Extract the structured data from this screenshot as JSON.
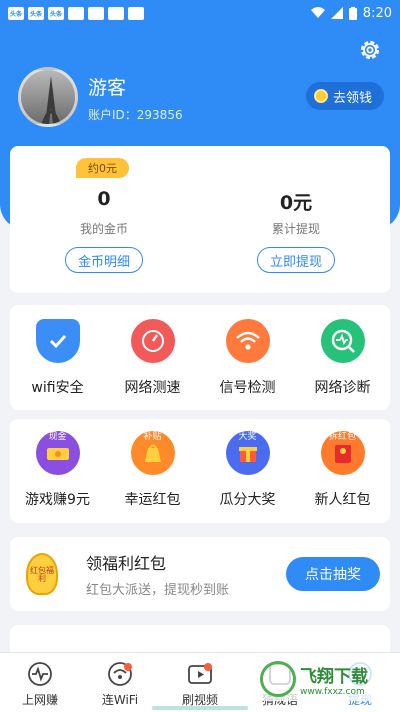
{
  "status_bar": {
    "time": "8:20",
    "left_icons": [
      "头条",
      "头条",
      "头条"
    ]
  },
  "profile": {
    "username": "游客",
    "account_id": "账户ID：293856",
    "go_button": "去领钱"
  },
  "stats": {
    "badge": "约0元",
    "coins": {
      "value": "0",
      "label": "我的金币",
      "button": "金币明细"
    },
    "withdraw": {
      "value": "0元",
      "label": "累计提现",
      "button": "立即提现"
    }
  },
  "tools": [
    {
      "label": "wifi安全",
      "icon": "shield-check-icon",
      "color": "#3a8ef6"
    },
    {
      "label": "网络测速",
      "icon": "speedometer-icon",
      "color": "#f25a5a"
    },
    {
      "label": "信号检测",
      "icon": "wifi-signal-icon",
      "color": "#ff7a3c"
    },
    {
      "label": "网络诊断",
      "icon": "diagnosis-icon",
      "color": "#27c27a"
    }
  ],
  "activities": [
    {
      "label": "游戏赚9元",
      "tag": "现金",
      "icon": "cash-game-icon",
      "color": "#8a4fe0"
    },
    {
      "label": "幸运红包",
      "tag": "补贴",
      "icon": "lucky-bag-icon",
      "color": "#ff8a2a"
    },
    {
      "label": "瓜分大奖",
      "tag": "大奖",
      "icon": "gift-box-icon",
      "color": "#4b6cf0"
    },
    {
      "label": "新人红包",
      "tag": "拆红包",
      "icon": "red-packet-icon",
      "color": "#ff7a2a"
    }
  ],
  "welfare": {
    "icon_text": "红包福利",
    "title": "领福利红包",
    "subtitle": "红包大派送，提现秒到账",
    "button": "点击抽奖"
  },
  "tabs": [
    {
      "label": "上网赚",
      "icon": "pulse-icon"
    },
    {
      "label": "连WiFi",
      "icon": "wifi-icon"
    },
    {
      "label": "刷视频",
      "icon": "video-icon"
    },
    {
      "label": "猜成语",
      "icon": "idiom-icon"
    },
    {
      "label": "提现",
      "icon": "withdraw-icon"
    }
  ],
  "watermark": {
    "title": "飞翔下载",
    "url": "www.fxxz.com"
  },
  "colors": {
    "primary": "#2f8bf5",
    "badge": "#ffc23a"
  }
}
